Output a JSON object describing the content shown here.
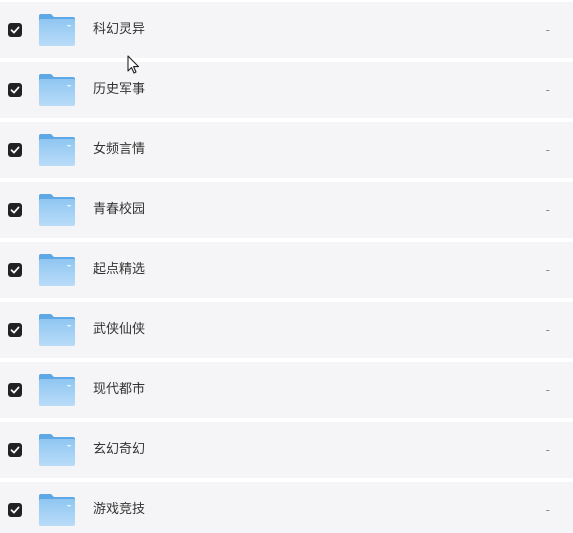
{
  "file_list": {
    "rows": [
      {
        "name": "科幻灵异",
        "size": "-",
        "checked": true
      },
      {
        "name": "历史军事",
        "size": "-",
        "checked": true
      },
      {
        "name": "女频言情",
        "size": "-",
        "checked": true
      },
      {
        "name": "青春校园",
        "size": "-",
        "checked": true
      },
      {
        "name": "起点精选",
        "size": "-",
        "checked": true
      },
      {
        "name": "武侠仙侠",
        "size": "-",
        "checked": true
      },
      {
        "name": "现代都市",
        "size": "-",
        "checked": true
      },
      {
        "name": "玄幻奇幻",
        "size": "-",
        "checked": true
      },
      {
        "name": "游戏竞技",
        "size": "-",
        "checked": true
      }
    ]
  },
  "icons": {
    "checkbox": "checkbox-checked-icon",
    "folder": "folder-icon",
    "cursor": "mouse-pointer-icon"
  },
  "colors": {
    "row_background": "#f5f5f7",
    "checkbox_fill": "#222222",
    "folder_blue": "#7cb9ec"
  }
}
